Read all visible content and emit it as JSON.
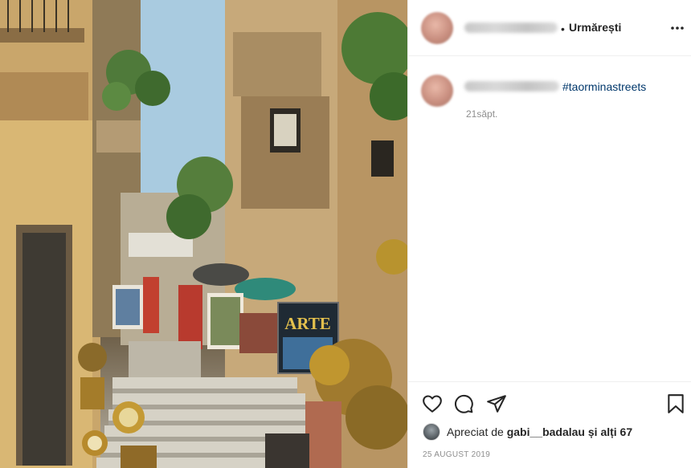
{
  "header": {
    "separator": "•",
    "follow_label": "Urmărești",
    "more_icon": "more-options-icon"
  },
  "caption": {
    "hashtag": "#taorminastreets",
    "time_ago": "21săpt."
  },
  "photo": {
    "sign_text": "ARTE"
  },
  "actions": {
    "like_icon": "heart-icon",
    "comment_icon": "comment-icon",
    "share_icon": "share-icon",
    "save_icon": "bookmark-icon"
  },
  "likes": {
    "prefix": "Apreciat de",
    "liker": "gabi__badalau",
    "suffix": "și alți 67"
  },
  "date": "25 AUGUST 2019",
  "colors": {
    "hashtag": "#00376b",
    "muted_text": "#8e8e8e",
    "divider": "#efefef"
  }
}
